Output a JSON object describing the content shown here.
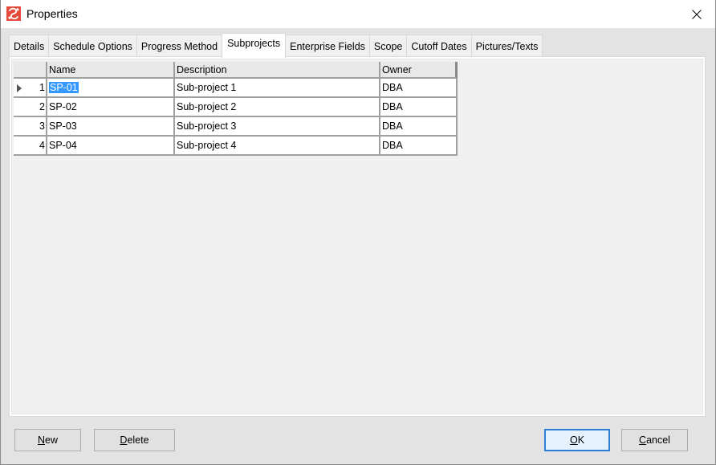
{
  "window": {
    "title": "Properties",
    "app_icon": "app-logo-icon",
    "close_icon": "close-icon"
  },
  "tabs": [
    {
      "label": "Details",
      "active": false
    },
    {
      "label": "Schedule Options",
      "active": false
    },
    {
      "label": "Progress Method",
      "active": false
    },
    {
      "label": "Subprojects",
      "active": true
    },
    {
      "label": "Enterprise Fields",
      "active": false
    },
    {
      "label": "Scope",
      "active": false
    },
    {
      "label": "Cutoff Dates",
      "active": false
    },
    {
      "label": "Pictures/Texts",
      "active": false
    }
  ],
  "grid": {
    "columns": [
      "Name",
      "Description",
      "Owner"
    ],
    "rows": [
      {
        "index": "1",
        "name": "SP-01",
        "description": "Sub-project 1",
        "owner": "DBA",
        "current": true
      },
      {
        "index": "2",
        "name": "SP-02",
        "description": "Sub-project 2",
        "owner": "DBA",
        "current": false
      },
      {
        "index": "3",
        "name": "SP-03",
        "description": "Sub-project 3",
        "owner": "DBA",
        "current": false
      },
      {
        "index": "4",
        "name": "SP-04",
        "description": "Sub-project 4",
        "owner": "DBA",
        "current": false
      }
    ]
  },
  "buttons": {
    "new": {
      "accel": "N",
      "rest": "ew"
    },
    "delete": {
      "accel": "D",
      "rest": "elete"
    },
    "ok": {
      "accel": "O",
      "rest": "K"
    },
    "cancel": {
      "accel": "C",
      "rest": "ancel"
    }
  },
  "colors": {
    "selection": "#3399ff",
    "default_button_border": "#2f7fd6",
    "app_icon": "#e64c3c"
  }
}
